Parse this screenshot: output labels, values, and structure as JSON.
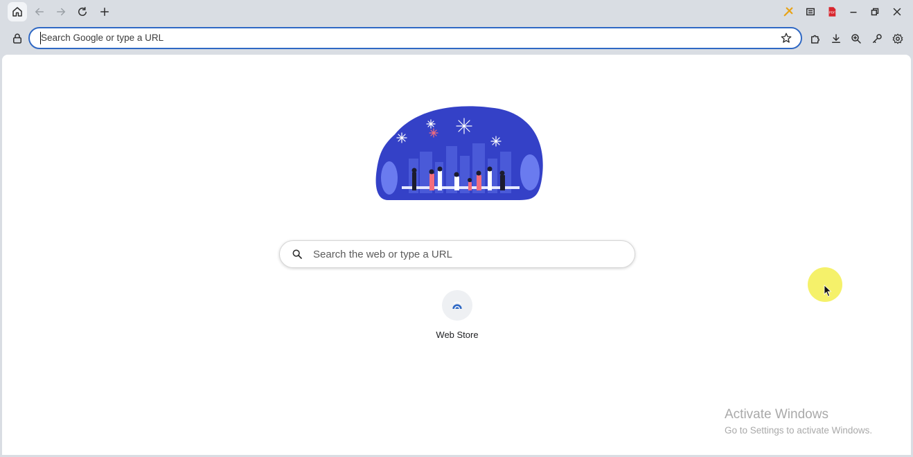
{
  "tabbar": {
    "icons": [
      "home-icon",
      "back-icon",
      "forward-icon",
      "reload-icon",
      "new-tab-icon"
    ],
    "right_icons": [
      "customize-icon",
      "reading-mode-icon",
      "pdf-icon",
      "minimize-icon",
      "restore-icon",
      "close-icon"
    ]
  },
  "toolbar": {
    "omnibox_placeholder": "Search Google or type a URL",
    "icons": [
      "lock-icon",
      "bookmark-star-icon",
      "extensions-icon",
      "download-icon",
      "zoom-icon",
      "passwords-key-icon",
      "settings-icon"
    ]
  },
  "ntp": {
    "search_placeholder": "Search the web or type a URL",
    "shortcuts": [
      {
        "label": "Web Store",
        "icon": "web-store-icon"
      }
    ]
  },
  "watermark": {
    "title": "Activate Windows",
    "subtitle": "Go to Settings to activate Windows."
  },
  "colors": {
    "accent": "#2f68c4",
    "hero_blue": "#3441c7",
    "chrome_bg": "#d9dde3",
    "highlight": "#f4f05a",
    "pdf_red": "#d8262e"
  }
}
